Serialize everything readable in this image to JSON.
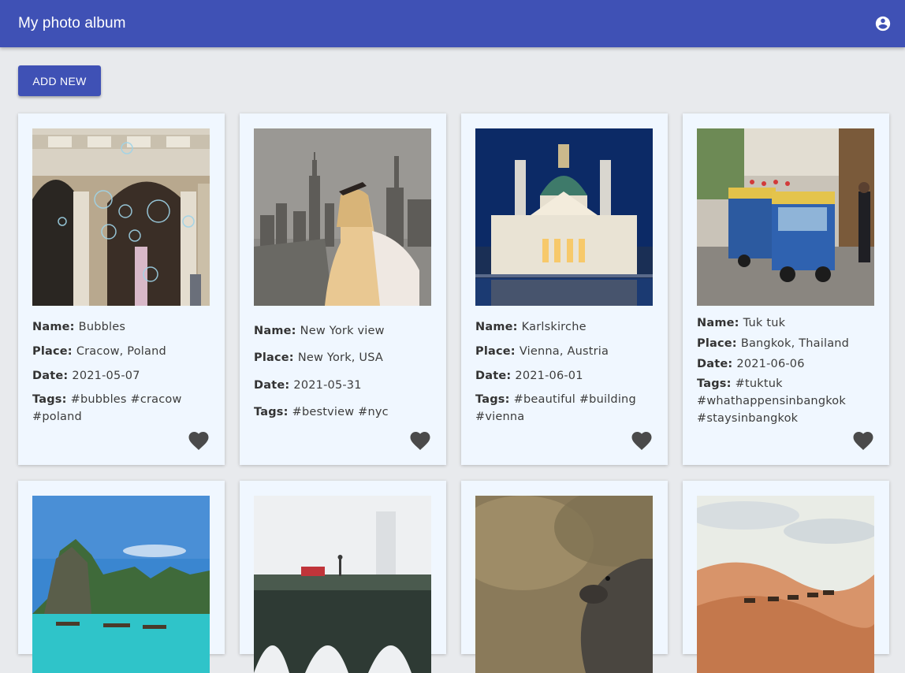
{
  "app": {
    "title": "My photo album",
    "account_icon": "account-circle-icon"
  },
  "toolbar": {
    "add_label": "ADD NEW"
  },
  "labels": {
    "name": "Name:",
    "place": "Place:",
    "date": "Date:",
    "tags": "Tags:"
  },
  "colors": {
    "appbar": "#3f51b5",
    "card": "#f0f7ff",
    "background": "#e8eaed",
    "heart": "#4a4a4a"
  },
  "photos": [
    {
      "name": "Bubbles",
      "place": "Cracow, Poland",
      "date": "2021-05-07",
      "tags": "#bubbles #cracow #poland"
    },
    {
      "name": "New York view",
      "place": "New York, USA",
      "date": "2021-05-31",
      "tags": "#bestview #nyc"
    },
    {
      "name": "Karlskirche",
      "place": "Vienna, Austria",
      "date": "2021-06-01",
      "tags": "#beautiful #building #vienna"
    },
    {
      "name": "Tuk tuk",
      "place": "Bangkok, Thailand",
      "date": "2021-06-06",
      "tags": "#tuktuk #whathappensinbangkok #staysinbangkok"
    }
  ]
}
